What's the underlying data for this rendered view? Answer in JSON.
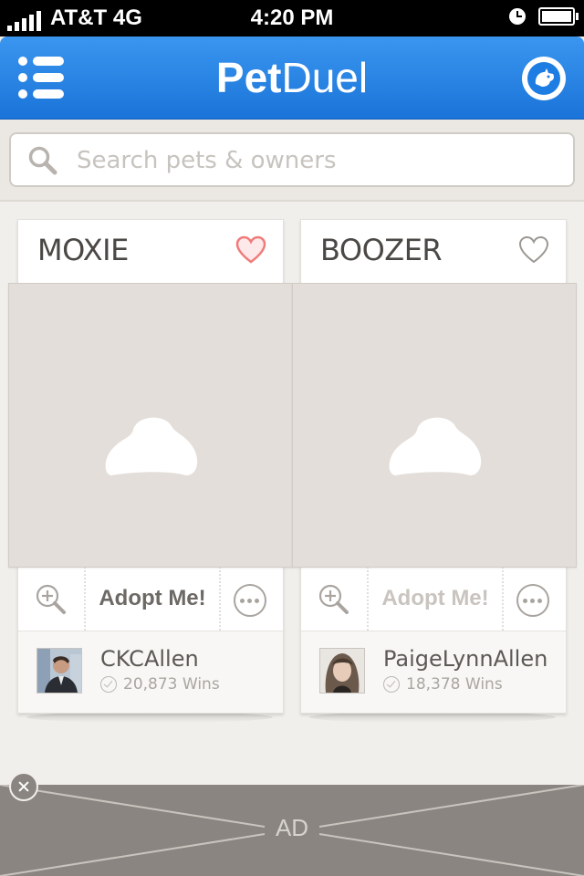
{
  "status_bar": {
    "carrier": "AT&T 4G",
    "time": "4:20 PM"
  },
  "nav": {
    "logo_bold": "Pet",
    "logo_light": "Duel",
    "menu_icon": "list-menu-icon",
    "profile_icon": "pet-profile-icon"
  },
  "search": {
    "placeholder": "Search pets & owners",
    "icon": "search-icon"
  },
  "cards": [
    {
      "pet_name": "MOXIE",
      "favorited": true,
      "adopt_label": "Adopt Me!",
      "adopt_enabled": true,
      "owner_name": "CKCAllen",
      "wins": "20,873 Wins"
    },
    {
      "pet_name": "BOOZER",
      "favorited": false,
      "adopt_label": "Adopt Me!",
      "adopt_enabled": false,
      "owner_name": "PaigeLynnAllen",
      "wins": "18,378 Wins"
    }
  ],
  "ad": {
    "label": "AD"
  },
  "colors": {
    "nav_blue": "#2a86e6",
    "heart_active": "#f07b7b",
    "heart_inactive": "#9c9792",
    "ad_gray": "#8a8580"
  }
}
